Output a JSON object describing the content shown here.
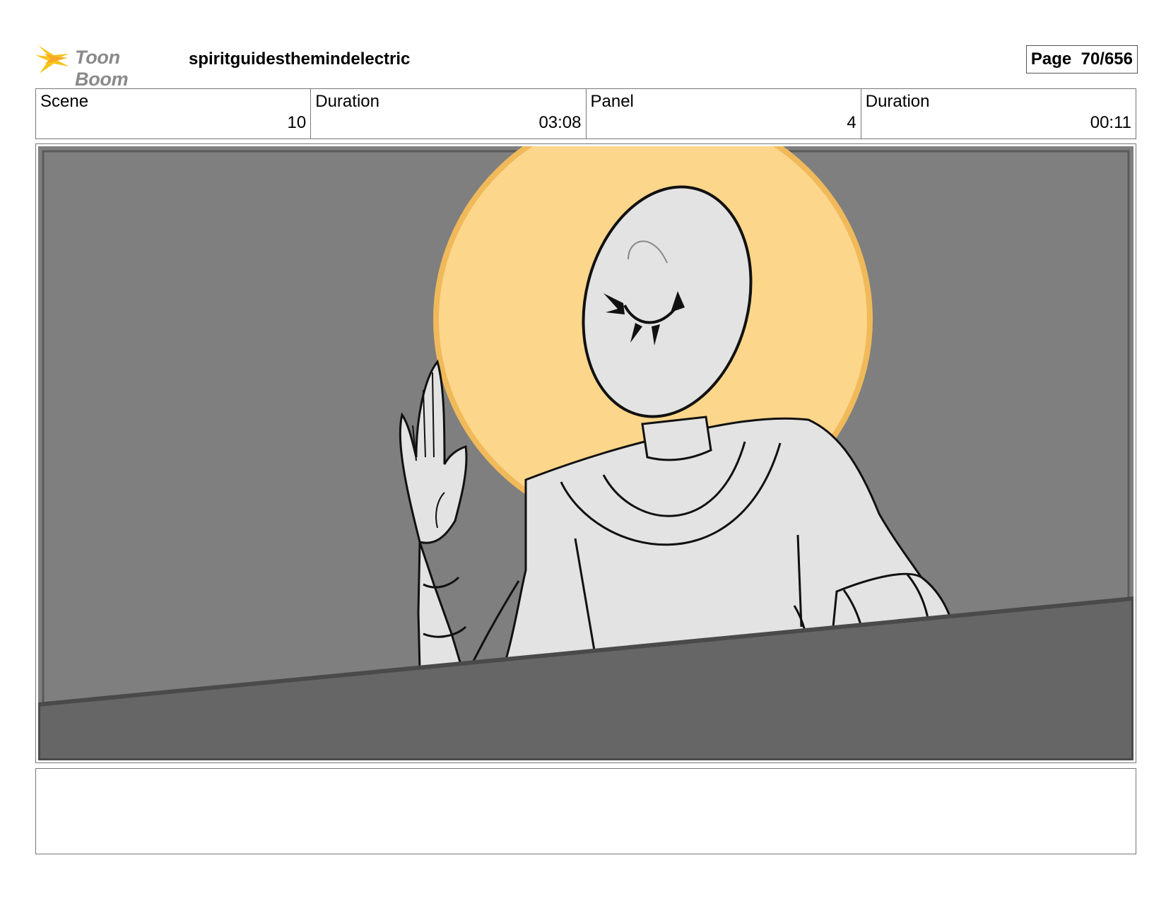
{
  "header": {
    "logo_text": "Toon Boom",
    "project_title": "spiritguidesthemindelectric",
    "page_label": "Page",
    "page_number": "70/656"
  },
  "info": {
    "scene_label": "Scene",
    "scene_value": "10",
    "scene_duration_label": "Duration",
    "scene_duration_value": "03:08",
    "panel_label": "Panel",
    "panel_value": "4",
    "panel_duration_label": "Duration",
    "panel_duration_value": "00:11"
  },
  "notes": {
    "text": ""
  },
  "colors": {
    "background_gray": "#7f7f7f",
    "halo": "#fcd68a",
    "figure": "#e3e3e3",
    "ledge": "#666666",
    "logo_accent": "#f5c518"
  }
}
